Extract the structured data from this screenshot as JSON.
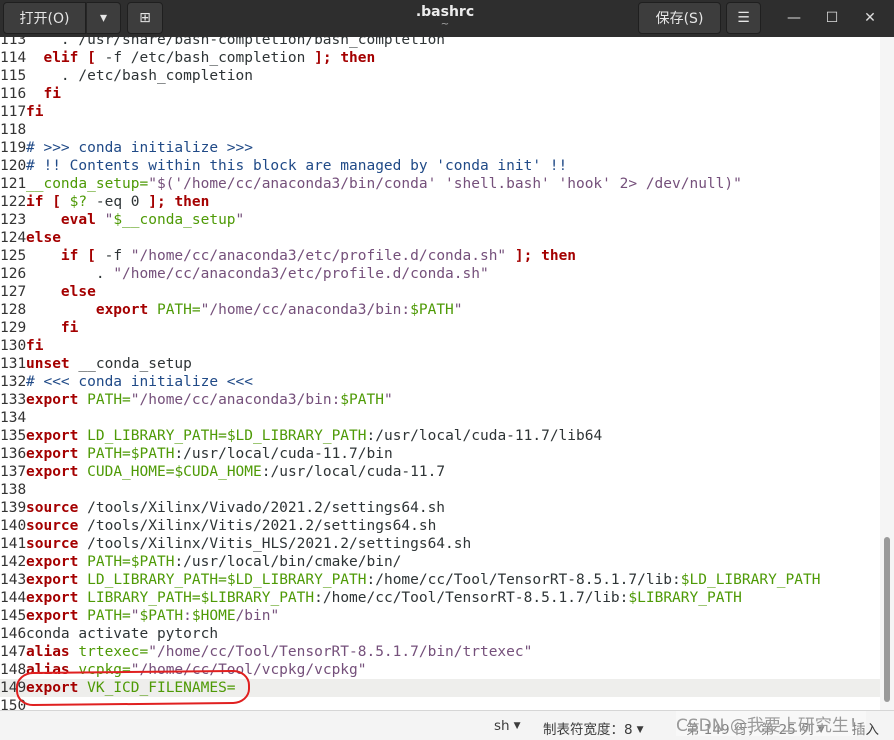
{
  "header": {
    "open_label": "打开(O)",
    "open_menu_icon": "▾",
    "new_tab_icon": "⊞",
    "title": ".bashrc",
    "subtitle": "~",
    "save_label": "保存(S)",
    "menu_icon": "☰",
    "minimize_icon": "—",
    "maximize_icon": "☐",
    "close_icon": "✕"
  },
  "editor": {
    "current_line": "149",
    "lines": [
      {
        "n": "113",
        "t": "    . /usr/share/bash-completion/bash_completion"
      },
      {
        "n": "114",
        "t": "  elif [ -f /etc/bash_completion ]; then"
      },
      {
        "n": "115",
        "t": "    . /etc/bash_completion"
      },
      {
        "n": "116",
        "t": "  fi"
      },
      {
        "n": "117",
        "t": "fi"
      },
      {
        "n": "118",
        "t": ""
      },
      {
        "n": "119",
        "t": "# >>> conda initialize >>>"
      },
      {
        "n": "120",
        "t": "# !! Contents within this block are managed by 'conda init' !!"
      },
      {
        "n": "121",
        "t": "__conda_setup=\"$('/home/cc/anaconda3/bin/conda' 'shell.bash' 'hook' 2> /dev/null)\""
      },
      {
        "n": "122",
        "t": "if [ $? -eq 0 ]; then"
      },
      {
        "n": "123",
        "t": "    eval \"$__conda_setup\""
      },
      {
        "n": "124",
        "t": "else"
      },
      {
        "n": "125",
        "t": "    if [ -f \"/home/cc/anaconda3/etc/profile.d/conda.sh\" ]; then"
      },
      {
        "n": "126",
        "t": "        . \"/home/cc/anaconda3/etc/profile.d/conda.sh\""
      },
      {
        "n": "127",
        "t": "    else"
      },
      {
        "n": "128",
        "t": "        export PATH=\"/home/cc/anaconda3/bin:$PATH\""
      },
      {
        "n": "129",
        "t": "    fi"
      },
      {
        "n": "130",
        "t": "fi"
      },
      {
        "n": "131",
        "t": "unset __conda_setup"
      },
      {
        "n": "132",
        "t": "# <<< conda initialize <<<"
      },
      {
        "n": "133",
        "t": "export PATH=\"/home/cc/anaconda3/bin:$PATH\""
      },
      {
        "n": "134",
        "t": ""
      },
      {
        "n": "135",
        "t": "export LD_LIBRARY_PATH=$LD_LIBRARY_PATH:/usr/local/cuda-11.7/lib64"
      },
      {
        "n": "136",
        "t": "export PATH=$PATH:/usr/local/cuda-11.7/bin"
      },
      {
        "n": "137",
        "t": "export CUDA_HOME=$CUDA_HOME:/usr/local/cuda-11.7"
      },
      {
        "n": "138",
        "t": ""
      },
      {
        "n": "139",
        "t": "source /tools/Xilinx/Vivado/2021.2/settings64.sh"
      },
      {
        "n": "140",
        "t": "source /tools/Xilinx/Vitis/2021.2/settings64.sh"
      },
      {
        "n": "141",
        "t": "source /tools/Xilinx/Vitis_HLS/2021.2/settings64.sh"
      },
      {
        "n": "142",
        "t": "export PATH=$PATH:/usr/local/bin/cmake/bin/"
      },
      {
        "n": "143",
        "t": "export LD_LIBRARY_PATH=$LD_LIBRARY_PATH:/home/cc/Tool/TensorRT-8.5.1.7/lib:$LD_LIBRARY_PATH"
      },
      {
        "n": "144",
        "t": "export LIBRARY_PATH=$LIBRARY_PATH:/home/cc/Tool/TensorRT-8.5.1.7/lib:$LIBRARY_PATH"
      },
      {
        "n": "145",
        "t": "export PATH=\"$PATH:$HOME/bin\""
      },
      {
        "n": "146",
        "t": "conda activate pytorch"
      },
      {
        "n": "147",
        "t": "alias trtexec=\"/home/cc/Tool/TensorRT-8.5.1.7/bin/trtexec\""
      },
      {
        "n": "148",
        "t": "alias vcpkg=\"/home/cc/Tool/vcpkg/vcpkg\""
      },
      {
        "n": "149",
        "t": "export VK_ICD_FILENAMES="
      },
      {
        "n": "150",
        "t": ""
      }
    ]
  },
  "statusbar": {
    "language": "sh",
    "tab_width": "制表符宽度：8",
    "position": "第 149 行，第 25 列",
    "insert_mode": "插入",
    "watermark": "CSDN @我要上研究生！"
  },
  "colors": {
    "keyword": "#a40000",
    "variable": "#4e9a06",
    "string": "#75507b",
    "comment": "#204a87",
    "annotation": "#e02020"
  }
}
